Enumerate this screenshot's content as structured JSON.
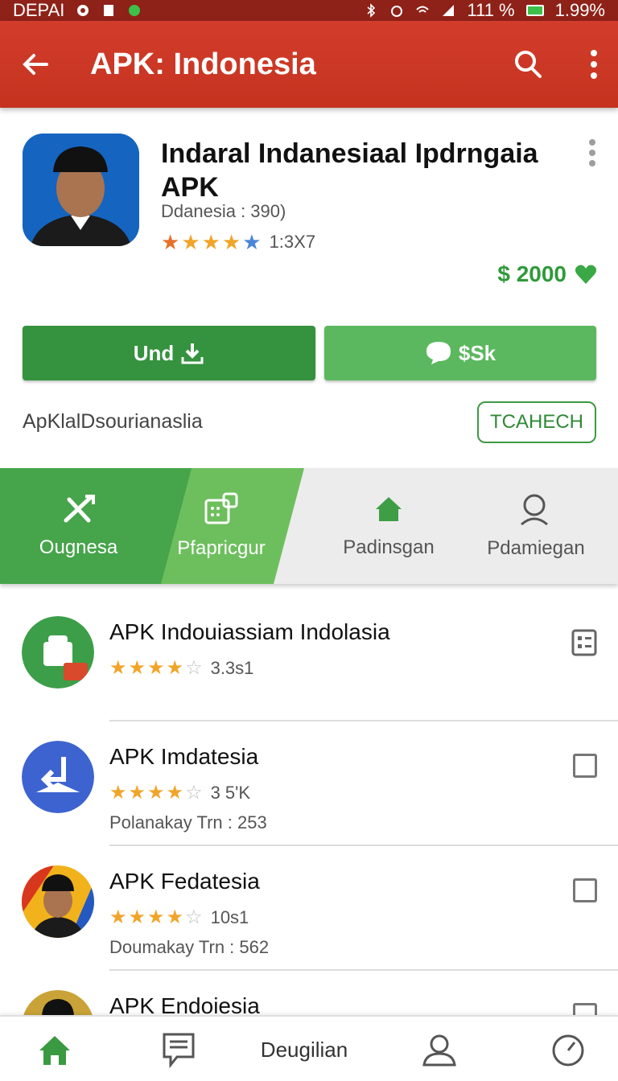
{
  "status_bar": {
    "left_text": "DEPAI",
    "battery_pct": "111 %",
    "time": "1.99%"
  },
  "app_bar": {
    "title": "APK: Indonesia"
  },
  "app": {
    "name": "Indaral Indanesiaal Ipdrngaia APK",
    "subtitle": "Ddanesia : 390)",
    "rating_count": "1:3X7",
    "stars_filled": 5,
    "price": "$ 2000"
  },
  "buttons": {
    "install_label": "Und",
    "share_label": "$Sk"
  },
  "developer": {
    "name": "ApKlalDsourianaslia",
    "tag_label": "TCAHECH"
  },
  "tabs": [
    {
      "label": "Ougnesa"
    },
    {
      "label": "Pfapricgur"
    },
    {
      "label": "Padinsgan"
    },
    {
      "label": "Pdamiegan"
    }
  ],
  "list": [
    {
      "title": "APK Indouiassiam Indolasia",
      "rating": "3.3s1",
      "stars": 3.5,
      "meta": ""
    },
    {
      "title": "APK Imdatesia",
      "rating": "3 5'K",
      "stars": 4,
      "meta": "Polanakay Trn : 253"
    },
    {
      "title": "APK Fedatesia",
      "rating": "10s1",
      "stars": 4,
      "meta": "Doumakay Trn : 562"
    },
    {
      "title": "APK Endoiesia",
      "rating": "",
      "stars": 0,
      "meta": ""
    }
  ],
  "bottom_nav": {
    "center_label": "Deugilian"
  },
  "colors": {
    "app_bar": "#d23d2b",
    "primary_green": "#35923e",
    "light_green": "#5cb85e"
  }
}
